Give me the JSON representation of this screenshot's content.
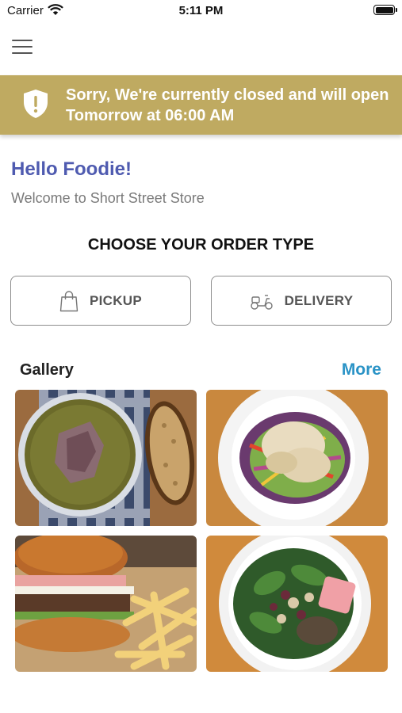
{
  "status_bar": {
    "carrier": "Carrier",
    "time": "5:11 PM"
  },
  "banner": {
    "message": "Sorry, We're currently closed and will open Tomorrow at 06:00 AM",
    "icon": "shield-alert-icon",
    "background": "#bfaa61"
  },
  "greeting": {
    "title": "Hello Foodie!",
    "subtitle": "Welcome to Short Street Store"
  },
  "order_type": {
    "heading": "CHOOSE YOUR ORDER TYPE",
    "pickup_label": "PICKUP",
    "delivery_label": "DELIVERY"
  },
  "gallery": {
    "title": "Gallery",
    "more_label": "More",
    "items": [
      "soup-photo",
      "salad-plate-photo",
      "burger-fries-photo",
      "green-salad-photo"
    ]
  },
  "colors": {
    "accent_link": "#2a93c6",
    "greeting": "#4f5bb0",
    "banner": "#bfaa61"
  }
}
